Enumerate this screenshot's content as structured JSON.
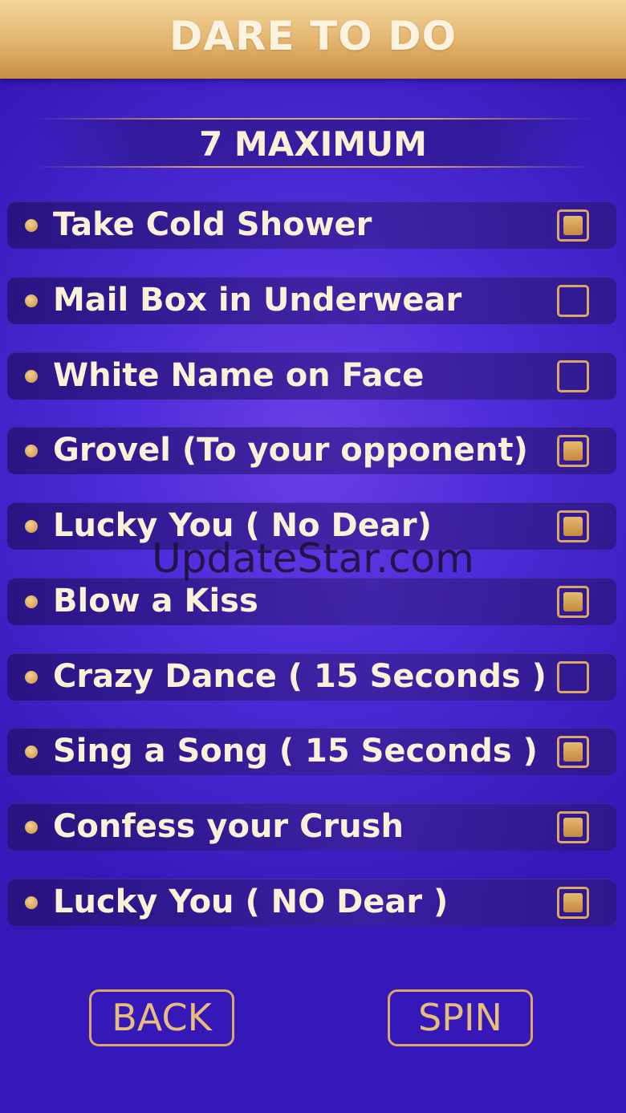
{
  "header": {
    "title": "DARE TO DO"
  },
  "subtitle": "7 MAXIMUM",
  "dares": [
    {
      "label": "Take Cold Shower",
      "checked": true
    },
    {
      "label": "Mail Box in Underwear",
      "checked": false
    },
    {
      "label": "White Name on Face",
      "checked": false
    },
    {
      "label": "Grovel  (To your opponent)",
      "checked": true
    },
    {
      "label": "Lucky You ( No Dear)",
      "checked": true
    },
    {
      "label": "Blow a Kiss",
      "checked": true
    },
    {
      "label": "Crazy Dance ( 15 Seconds )",
      "checked": false
    },
    {
      "label": "Sing a Song ( 15 Seconds )",
      "checked": true
    },
    {
      "label": "Confess your Crush",
      "checked": true
    },
    {
      "label": "Lucky You ( NO Dear )",
      "checked": true
    }
  ],
  "watermark": "UpdateStar.com",
  "buttons": {
    "back_label": "BACK",
    "spin_label": "SPIN"
  },
  "colors": {
    "accent_gold": "#d9a868",
    "background_purple": "#4d2bd8",
    "text_cream": "#fbf0d8"
  }
}
